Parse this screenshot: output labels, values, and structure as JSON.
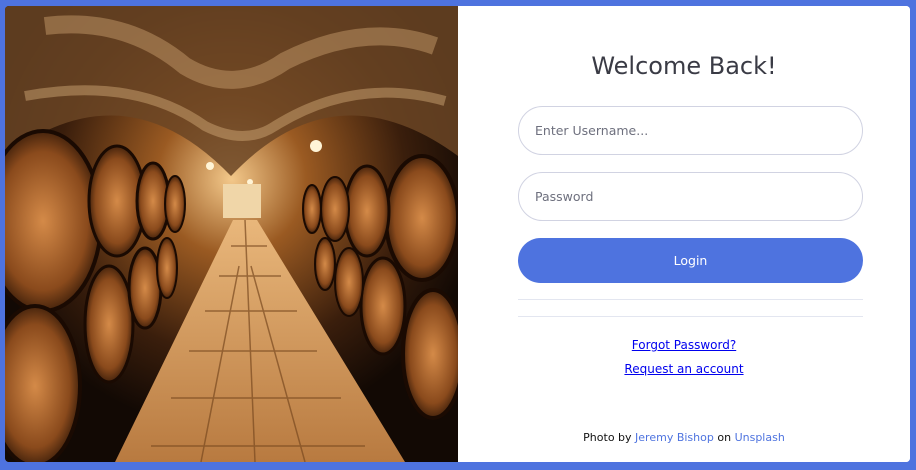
{
  "login": {
    "title": "Welcome Back!",
    "username_placeholder": "Enter Username...",
    "password_placeholder": "Password",
    "login_label": "Login",
    "forgot_password": "Forgot Password?",
    "request_account": "Request an account"
  },
  "credit": {
    "prefix": "Photo by",
    "author": "Jeremy Bishop",
    "middle": "on",
    "source": "Unsplash"
  },
  "colors": {
    "primary": "#4e73df",
    "text": "#3a3b45",
    "border": "#d1d3e2"
  },
  "photo": {
    "subject": "wine-cellar-barrels-image"
  }
}
